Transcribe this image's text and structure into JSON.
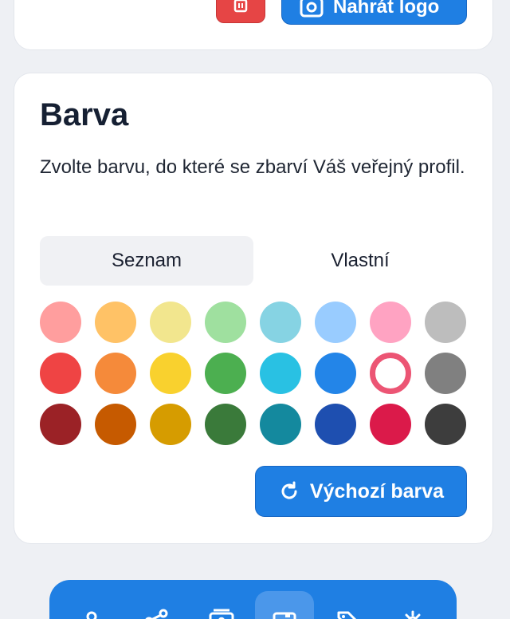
{
  "logo_card": {
    "delete_icon": "trash-icon",
    "upload_icon": "image-icon",
    "upload_label": "Nahrát logo"
  },
  "color_card": {
    "title": "Barva",
    "description": "Zvolte barvu, do které se zbarví Váš veřejný profil.",
    "tabs": [
      {
        "label": "Seznam",
        "active": true
      },
      {
        "label": "Vlastní",
        "active": false
      }
    ],
    "swatch_rows": [
      [
        "#ff9e9e",
        "#ffc266",
        "#f2e68e",
        "#9fe09f",
        "#86d3e3",
        "#99ccff",
        "#ffa3c2",
        "#bdbdbd"
      ],
      [
        "#ef4444",
        "#f58a3a",
        "#f9d12e",
        "#4caf50",
        "#29c1e3",
        "#2385e8",
        "#ec5574",
        "#808080"
      ],
      [
        "#9b2226",
        "#c65a00",
        "#d69c00",
        "#3a7a3a",
        "#14899e",
        "#1e4fb0",
        "#db1a4a",
        "#3d3d3d"
      ]
    ],
    "selected_swatch": "#ec5574",
    "reset_icon": "refresh-icon",
    "reset_label": "Výchozí barva"
  },
  "bottom_nav": {
    "items": [
      {
        "icon": "user-icon",
        "active": false
      },
      {
        "icon": "share-icon",
        "active": false
      },
      {
        "icon": "id-card-icon",
        "active": false
      },
      {
        "icon": "image-icon",
        "active": true
      },
      {
        "icon": "tag-icon",
        "active": false
      },
      {
        "icon": "gear-icon",
        "active": false
      }
    ]
  },
  "colors": {
    "primary": "#1f7fe3",
    "danger": "#e64545",
    "background": "#eef0f4"
  }
}
